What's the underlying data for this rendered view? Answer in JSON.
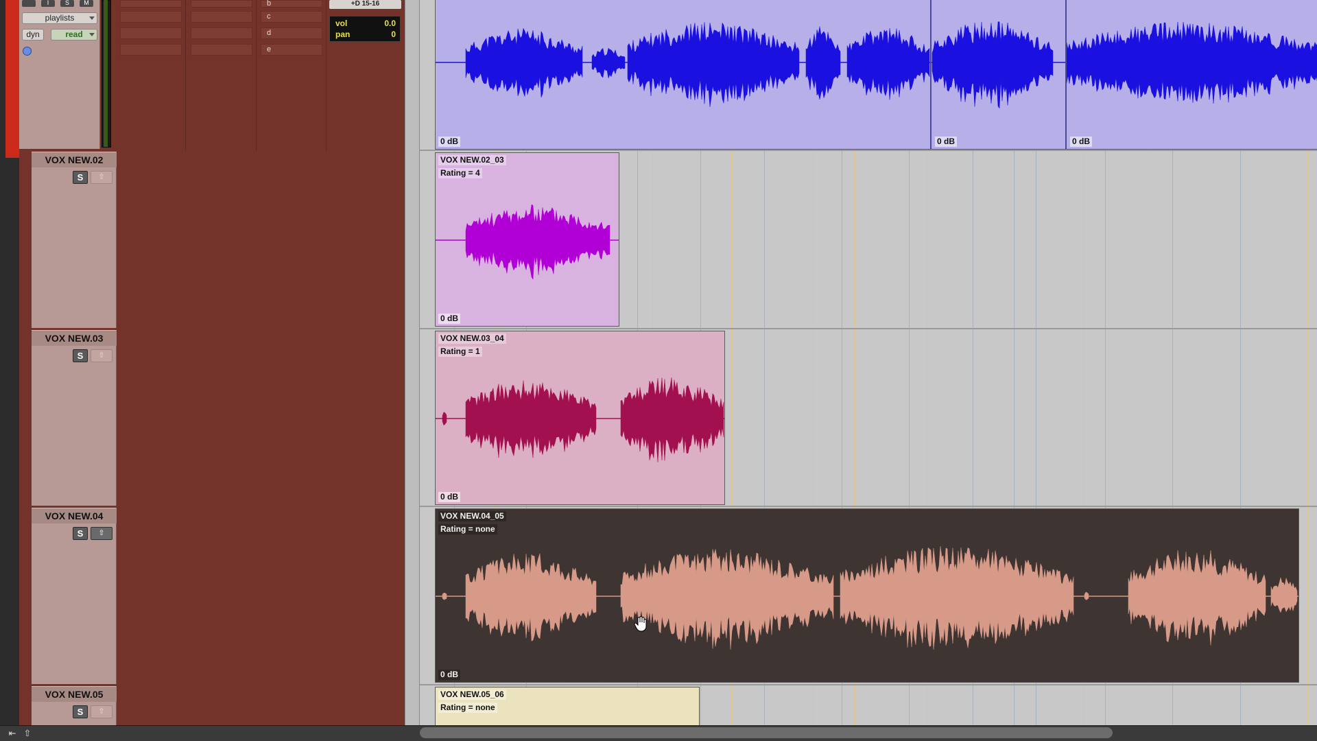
{
  "top_track": {
    "buttons": [
      "",
      "I",
      "S",
      "M"
    ],
    "playlists_label": "playlists",
    "dyn_label": "dyn",
    "automation_mode": "read",
    "slots_col3": [
      "b",
      "c",
      "d",
      "e"
    ],
    "io_label": "+D 15-16",
    "vol_label": "vol",
    "vol_value": "0.0",
    "pan_label": "pan",
    "pan_value": "0",
    "clip_gains": [
      "0 dB",
      "0 dB",
      "0 dB"
    ],
    "waveform_color": "#1a10e0"
  },
  "tracks": [
    {
      "name": "VOX NEW.02",
      "solo_label": "S",
      "clip": {
        "name": "VOX NEW.02_03",
        "rating": "Rating = 4",
        "gain": "0 dB",
        "color": "#d9b3e0",
        "wave": "#b100d6"
      }
    },
    {
      "name": "VOX NEW.03",
      "solo_label": "S",
      "clip": {
        "name": "VOX NEW.03_04",
        "rating": "Rating = 1",
        "gain": "0 dB",
        "color": "#dcb0c4",
        "wave": "#a3104f"
      }
    },
    {
      "name": "VOX NEW.04",
      "solo_label": "S",
      "clip": {
        "name": "VOX NEW.04_05",
        "rating": "Rating = none",
        "gain": "0 dB",
        "color": "#3e3431",
        "wave": "#d79a88"
      }
    },
    {
      "name": "VOX NEW.05",
      "solo_label": "S",
      "clip": {
        "name": "VOX NEW.05_06",
        "rating": "Rating = none",
        "gain": "",
        "color": "#ebe3bd",
        "wave": ""
      }
    }
  ],
  "bottom_bar": {
    "icons": [
      "go-to-start-icon",
      "upload-icon"
    ],
    "glyphs": [
      "⇤",
      "⇧"
    ]
  }
}
